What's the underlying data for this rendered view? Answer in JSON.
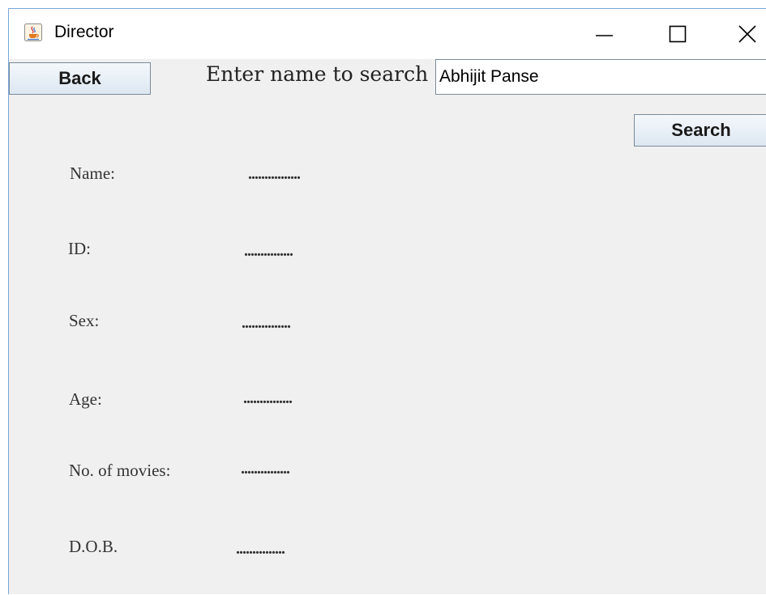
{
  "window": {
    "title": "Director",
    "icon": "java-cup-icon"
  },
  "toolbar": {
    "back_label": "Back",
    "search_prompt": "Enter name to search",
    "search_value": "Abhijit Panse",
    "search_label": "Search"
  },
  "fields": [
    {
      "label": "Name:",
      "value": "................"
    },
    {
      "label": "ID:",
      "value": "..............."
    },
    {
      "label": "Sex:",
      "value": "..............."
    },
    {
      "label": "Age:",
      "value": "..............."
    },
    {
      "label": "No. of movies:",
      "value": "..............."
    },
    {
      "label": "D.O.B.",
      "value": "..............."
    }
  ],
  "colors": {
    "window_bg": "#f0f0f0",
    "titlebar_bg": "#ffffff",
    "window_border": "#7aa7d8"
  }
}
